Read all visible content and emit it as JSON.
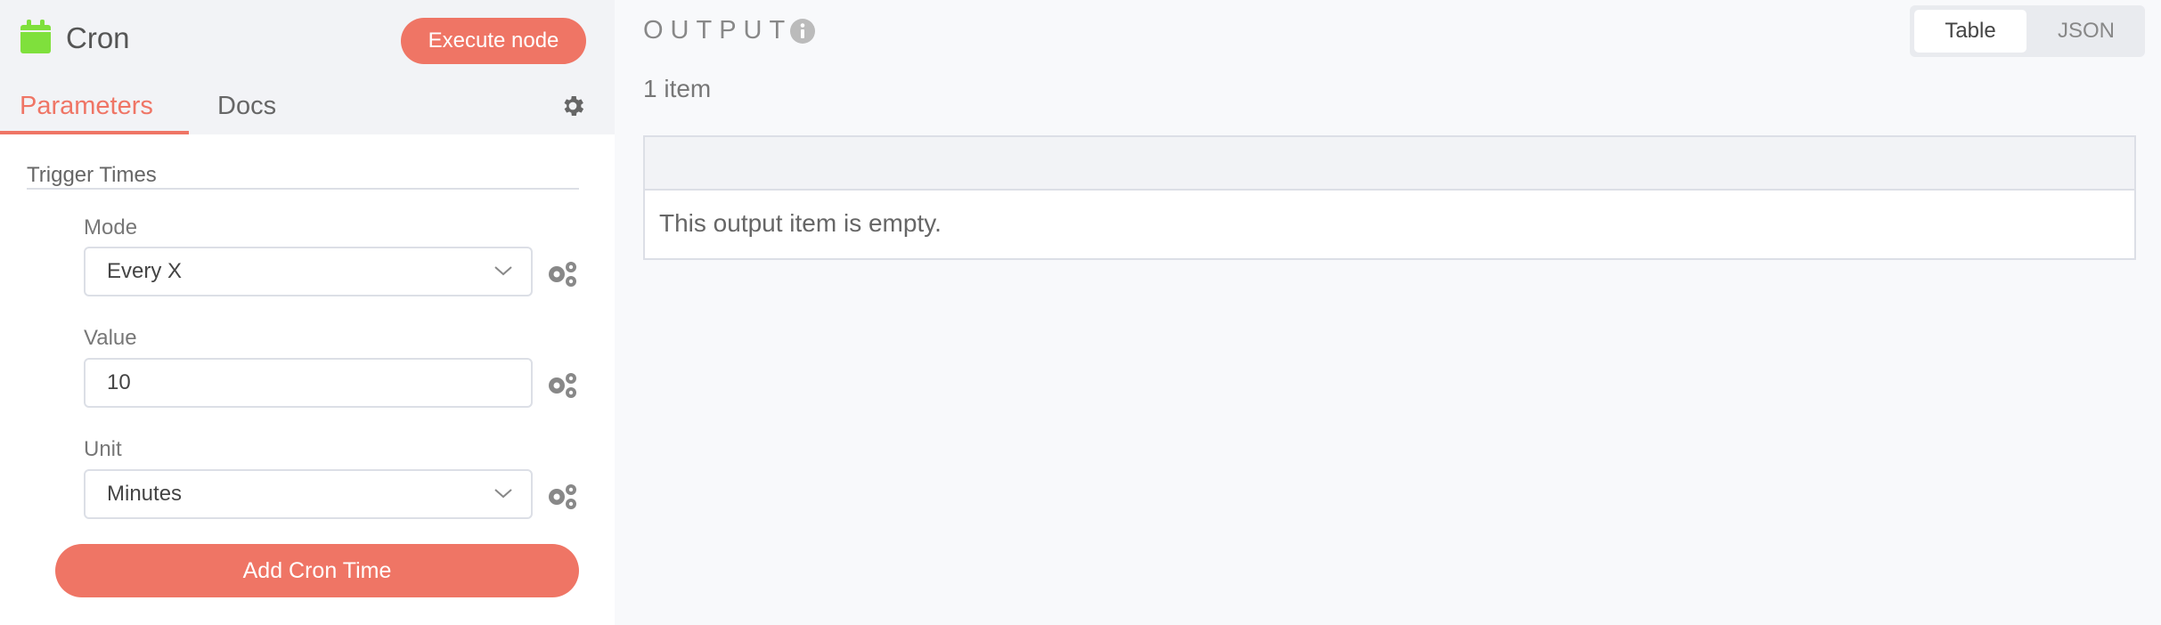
{
  "node": {
    "title": "Cron",
    "execute_label": "Execute node",
    "icon": "calendar-icon"
  },
  "tabs": [
    {
      "label": "Parameters",
      "active": true
    },
    {
      "label": "Docs",
      "active": false
    }
  ],
  "section": {
    "title": "Trigger Times"
  },
  "fields": {
    "mode": {
      "label": "Mode",
      "value": "Every X"
    },
    "value": {
      "label": "Value",
      "value": "10"
    },
    "unit": {
      "label": "Unit",
      "value": "Minutes"
    }
  },
  "add_label": "Add Cron Time",
  "output": {
    "title": "OUTPUT",
    "count": "1 item",
    "views": [
      "Table",
      "JSON"
    ],
    "selected_view": "Table",
    "empty_message": "This output item is empty."
  },
  "colors": {
    "accent": "#ef7565",
    "node_icon": "#7fe03c"
  }
}
